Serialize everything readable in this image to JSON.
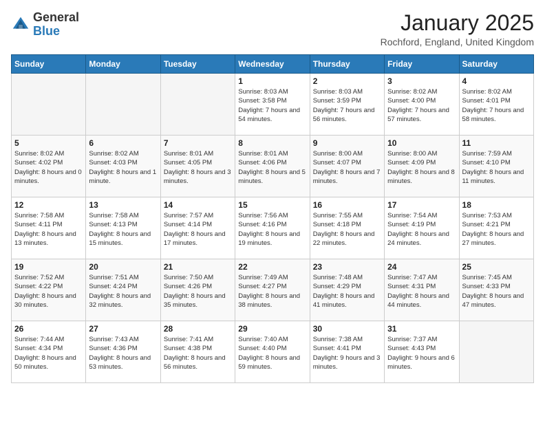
{
  "header": {
    "logo_general": "General",
    "logo_blue": "Blue",
    "month_title": "January 2025",
    "location": "Rochford, England, United Kingdom"
  },
  "days_of_week": [
    "Sunday",
    "Monday",
    "Tuesday",
    "Wednesday",
    "Thursday",
    "Friday",
    "Saturday"
  ],
  "weeks": [
    [
      {
        "day": "",
        "info": ""
      },
      {
        "day": "",
        "info": ""
      },
      {
        "day": "",
        "info": ""
      },
      {
        "day": "1",
        "info": "Sunrise: 8:03 AM\nSunset: 3:58 PM\nDaylight: 7 hours and 54 minutes."
      },
      {
        "day": "2",
        "info": "Sunrise: 8:03 AM\nSunset: 3:59 PM\nDaylight: 7 hours and 56 minutes."
      },
      {
        "day": "3",
        "info": "Sunrise: 8:02 AM\nSunset: 4:00 PM\nDaylight: 7 hours and 57 minutes."
      },
      {
        "day": "4",
        "info": "Sunrise: 8:02 AM\nSunset: 4:01 PM\nDaylight: 7 hours and 58 minutes."
      }
    ],
    [
      {
        "day": "5",
        "info": "Sunrise: 8:02 AM\nSunset: 4:02 PM\nDaylight: 8 hours and 0 minutes."
      },
      {
        "day": "6",
        "info": "Sunrise: 8:02 AM\nSunset: 4:03 PM\nDaylight: 8 hours and 1 minute."
      },
      {
        "day": "7",
        "info": "Sunrise: 8:01 AM\nSunset: 4:05 PM\nDaylight: 8 hours and 3 minutes."
      },
      {
        "day": "8",
        "info": "Sunrise: 8:01 AM\nSunset: 4:06 PM\nDaylight: 8 hours and 5 minutes."
      },
      {
        "day": "9",
        "info": "Sunrise: 8:00 AM\nSunset: 4:07 PM\nDaylight: 8 hours and 7 minutes."
      },
      {
        "day": "10",
        "info": "Sunrise: 8:00 AM\nSunset: 4:09 PM\nDaylight: 8 hours and 8 minutes."
      },
      {
        "day": "11",
        "info": "Sunrise: 7:59 AM\nSunset: 4:10 PM\nDaylight: 8 hours and 11 minutes."
      }
    ],
    [
      {
        "day": "12",
        "info": "Sunrise: 7:58 AM\nSunset: 4:11 PM\nDaylight: 8 hours and 13 minutes."
      },
      {
        "day": "13",
        "info": "Sunrise: 7:58 AM\nSunset: 4:13 PM\nDaylight: 8 hours and 15 minutes."
      },
      {
        "day": "14",
        "info": "Sunrise: 7:57 AM\nSunset: 4:14 PM\nDaylight: 8 hours and 17 minutes."
      },
      {
        "day": "15",
        "info": "Sunrise: 7:56 AM\nSunset: 4:16 PM\nDaylight: 8 hours and 19 minutes."
      },
      {
        "day": "16",
        "info": "Sunrise: 7:55 AM\nSunset: 4:18 PM\nDaylight: 8 hours and 22 minutes."
      },
      {
        "day": "17",
        "info": "Sunrise: 7:54 AM\nSunset: 4:19 PM\nDaylight: 8 hours and 24 minutes."
      },
      {
        "day": "18",
        "info": "Sunrise: 7:53 AM\nSunset: 4:21 PM\nDaylight: 8 hours and 27 minutes."
      }
    ],
    [
      {
        "day": "19",
        "info": "Sunrise: 7:52 AM\nSunset: 4:22 PM\nDaylight: 8 hours and 30 minutes."
      },
      {
        "day": "20",
        "info": "Sunrise: 7:51 AM\nSunset: 4:24 PM\nDaylight: 8 hours and 32 minutes."
      },
      {
        "day": "21",
        "info": "Sunrise: 7:50 AM\nSunset: 4:26 PM\nDaylight: 8 hours and 35 minutes."
      },
      {
        "day": "22",
        "info": "Sunrise: 7:49 AM\nSunset: 4:27 PM\nDaylight: 8 hours and 38 minutes."
      },
      {
        "day": "23",
        "info": "Sunrise: 7:48 AM\nSunset: 4:29 PM\nDaylight: 8 hours and 41 minutes."
      },
      {
        "day": "24",
        "info": "Sunrise: 7:47 AM\nSunset: 4:31 PM\nDaylight: 8 hours and 44 minutes."
      },
      {
        "day": "25",
        "info": "Sunrise: 7:45 AM\nSunset: 4:33 PM\nDaylight: 8 hours and 47 minutes."
      }
    ],
    [
      {
        "day": "26",
        "info": "Sunrise: 7:44 AM\nSunset: 4:34 PM\nDaylight: 8 hours and 50 minutes."
      },
      {
        "day": "27",
        "info": "Sunrise: 7:43 AM\nSunset: 4:36 PM\nDaylight: 8 hours and 53 minutes."
      },
      {
        "day": "28",
        "info": "Sunrise: 7:41 AM\nSunset: 4:38 PM\nDaylight: 8 hours and 56 minutes."
      },
      {
        "day": "29",
        "info": "Sunrise: 7:40 AM\nSunset: 4:40 PM\nDaylight: 8 hours and 59 minutes."
      },
      {
        "day": "30",
        "info": "Sunrise: 7:38 AM\nSunset: 4:41 PM\nDaylight: 9 hours and 3 minutes."
      },
      {
        "day": "31",
        "info": "Sunrise: 7:37 AM\nSunset: 4:43 PM\nDaylight: 9 hours and 6 minutes."
      },
      {
        "day": "",
        "info": ""
      }
    ]
  ]
}
